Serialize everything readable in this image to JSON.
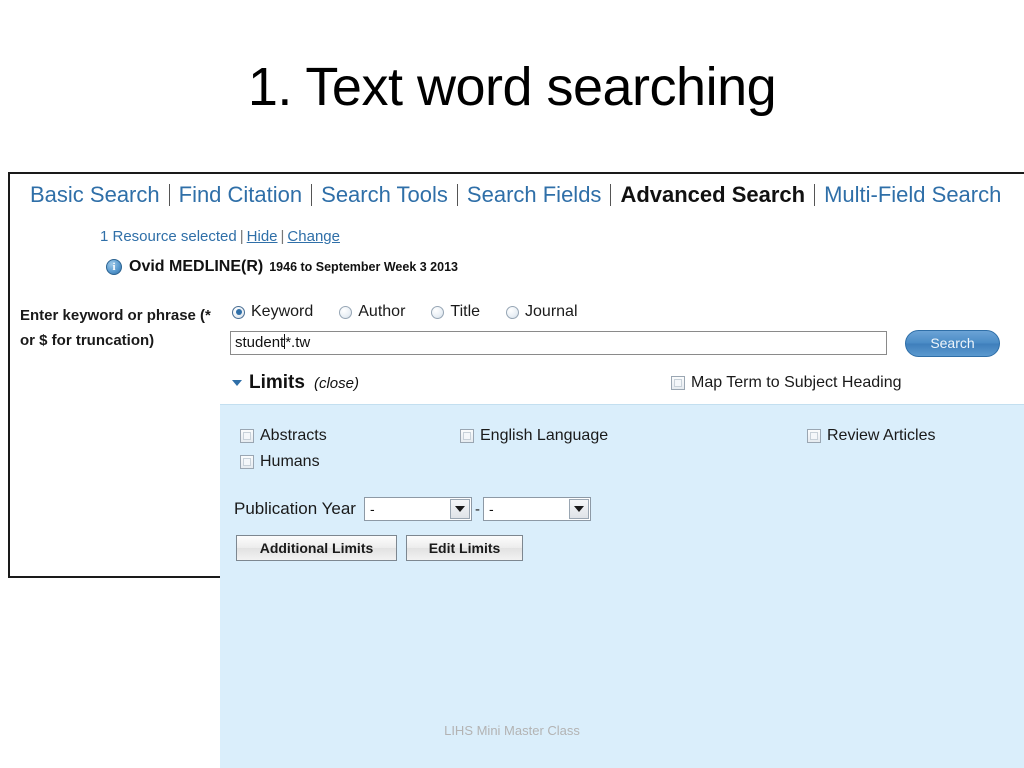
{
  "slide": {
    "title": "1. Text word searching",
    "footer": "LIHS Mini Master Class"
  },
  "ovid": {
    "nav_tabs": [
      {
        "label": "Basic Search",
        "active": false
      },
      {
        "label": "Find Citation",
        "active": false
      },
      {
        "label": "Search Tools",
        "active": false
      },
      {
        "label": "Search Fields",
        "active": false
      },
      {
        "label": "Advanced Search",
        "active": true
      },
      {
        "label": "Multi-Field Search",
        "active": false
      }
    ],
    "resource": {
      "selected_text": "1 Resource selected",
      "hide_label": "Hide",
      "change_label": "Change",
      "separator": "|"
    },
    "database": {
      "info_glyph": "i",
      "name": "Ovid MEDLINE(R)",
      "coverage": "1946 to September Week 3 2013"
    },
    "keyword_hint": "Enter keyword or phrase (* or $ for truncation)",
    "search_modes": [
      {
        "label": "Keyword",
        "selected": true
      },
      {
        "label": "Author",
        "selected": false
      },
      {
        "label": "Title",
        "selected": false
      },
      {
        "label": "Journal",
        "selected": false
      }
    ],
    "search_input": {
      "value_before_caret": "student",
      "value_after_caret": "*.tw",
      "full_value": "student*.tw",
      "placeholder": ""
    },
    "search_button_label": "Search",
    "limits": {
      "toggle_label": "Limits",
      "toggle_state_label": "(close)",
      "expanded": true,
      "map_term_label": "Map Term to Subject Heading",
      "map_term_checked": false,
      "checkboxes": [
        {
          "label": "Abstracts",
          "checked": false
        },
        {
          "label": "English Language",
          "checked": false
        },
        {
          "label": "Review Articles",
          "checked": false
        },
        {
          "label": "Humans",
          "checked": false
        }
      ],
      "publication_year": {
        "label": "Publication Year",
        "from_value": "-",
        "to_value": "-",
        "separator": "-"
      },
      "buttons": {
        "additional_limits": "Additional Limits",
        "edit_limits": "Edit Limits"
      }
    },
    "colors": {
      "link_blue": "#2f6fa8",
      "limits_panel_bg": "#daeefb",
      "search_button_blue": "#4b8cc6"
    }
  }
}
